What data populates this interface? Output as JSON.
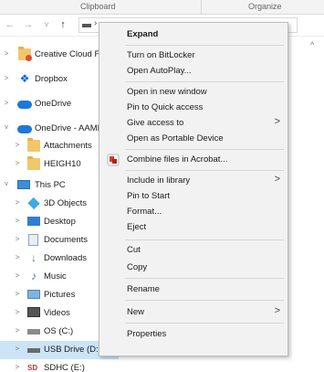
{
  "ribbon": {
    "groups": [
      {
        "label": "Clipboard"
      },
      {
        "label": "Organize"
      }
    ]
  },
  "nav": {
    "back": "←",
    "forward": "→",
    "recent": "˅",
    "up": "↑",
    "address_chevron": "›"
  },
  "tree": {
    "items": [
      {
        "label": "Creative Cloud Fi",
        "icon": "creative-cloud-folder-icon",
        "expander": ">"
      },
      {
        "label": "Dropbox",
        "icon": "dropbox-icon",
        "expander": ">"
      },
      {
        "label": "OneDrive",
        "icon": "onedrive-cloud-icon",
        "expander": ">"
      },
      {
        "label": "OneDrive - AAMP",
        "icon": "onedrive-cloud-icon",
        "expander": "˅"
      },
      {
        "label": "Attachments",
        "icon": "folder-icon",
        "expander": ">"
      },
      {
        "label": "HEIGH10",
        "icon": "folder-icon",
        "expander": ">"
      },
      {
        "label": "This PC",
        "icon": "this-pc-icon",
        "expander": "˅"
      },
      {
        "label": "3D Objects",
        "icon": "3d-objects-icon",
        "expander": ">"
      },
      {
        "label": "Desktop",
        "icon": "desktop-icon",
        "expander": ">"
      },
      {
        "label": "Documents",
        "icon": "documents-icon",
        "expander": ">"
      },
      {
        "label": "Downloads",
        "icon": "downloads-icon",
        "expander": ">"
      },
      {
        "label": "Music",
        "icon": "music-icon",
        "expander": ">"
      },
      {
        "label": "Pictures",
        "icon": "pictures-icon",
        "expander": ">"
      },
      {
        "label": "Videos",
        "icon": "videos-icon",
        "expander": ">"
      },
      {
        "label": "OS (C:)",
        "icon": "os-drive-icon",
        "expander": ">"
      },
      {
        "label": "USB Drive (D:)",
        "icon": "usb-drive-icon",
        "expander": ">",
        "selected": true
      },
      {
        "label": "SDHC (E:)",
        "icon": "sd-card-icon",
        "expander": ">"
      }
    ]
  },
  "context_menu": {
    "items": [
      {
        "label": "Expand",
        "bold": true
      },
      {
        "label": "Turn on BitLocker"
      },
      {
        "label": "Open AutoPlay..."
      },
      {
        "label": "Open in new window"
      },
      {
        "label": "Pin to Quick access"
      },
      {
        "label": "Give access to",
        "submenu": true
      },
      {
        "label": "Open as Portable Device"
      },
      {
        "label": "Combine files in Acrobat...",
        "icon": "acrobat-icon"
      },
      {
        "label": "Include in library",
        "submenu": true
      },
      {
        "label": "Pin to Start"
      },
      {
        "label": "Format..."
      },
      {
        "label": "Eject"
      },
      {
        "label": "Cut"
      },
      {
        "label": "Copy"
      },
      {
        "label": "Rename"
      },
      {
        "label": "New",
        "submenu": true
      },
      {
        "label": "Properties"
      }
    ],
    "submenu_arrow": ">"
  },
  "colors": {
    "selection": "#cce4f7",
    "menu_bg": "#f2f2f2",
    "accent": "#1e78d6"
  }
}
